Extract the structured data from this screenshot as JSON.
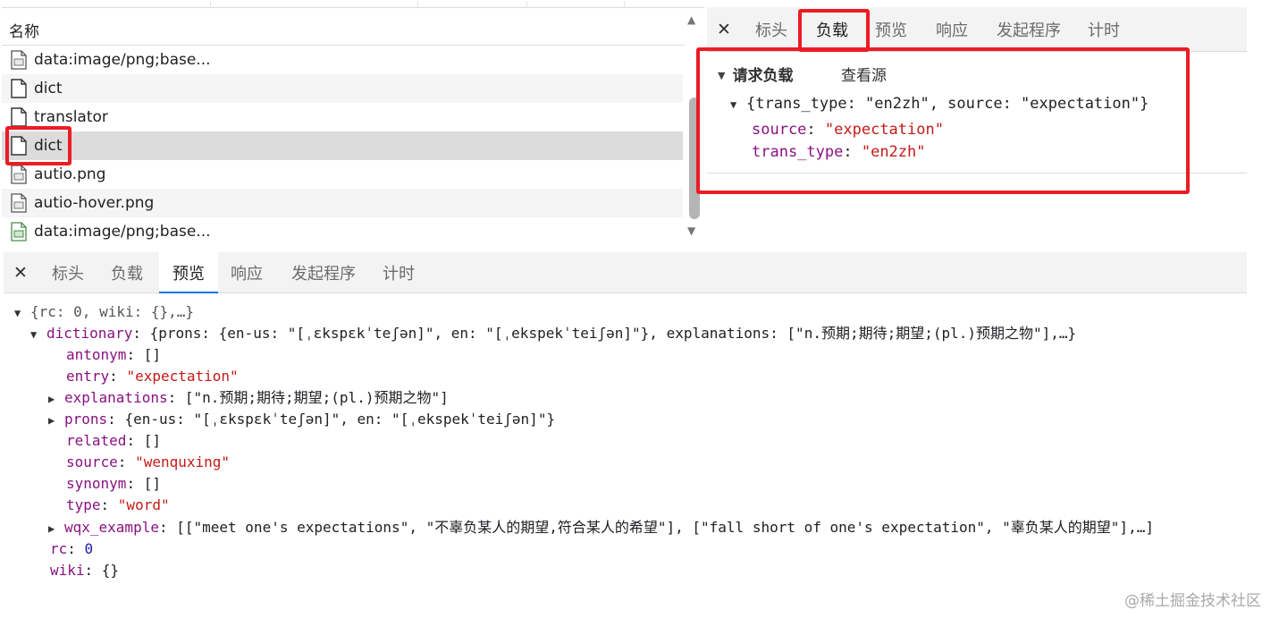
{
  "request_list": {
    "header": "名称",
    "rows": [
      {
        "name": "data:image/png;base...",
        "icon": "image-file-icon"
      },
      {
        "name": "dict",
        "icon": "document-file-icon"
      },
      {
        "name": "translator",
        "icon": "document-file-icon"
      },
      {
        "name": "dict",
        "icon": "document-file-icon",
        "selected": true
      },
      {
        "name": "autio.png",
        "icon": "image-file-icon"
      },
      {
        "name": "autio-hover.png",
        "icon": "image-file-icon"
      },
      {
        "name": "data:image/png;base...",
        "icon": "image-file-green-icon"
      }
    ]
  },
  "detail_tabs": {
    "close": "✕",
    "items": [
      "标头",
      "负载",
      "预览",
      "响应",
      "发起程序",
      "计时"
    ],
    "active": "负载"
  },
  "payload": {
    "title": "请求负载",
    "view_source": "查看源",
    "summary": "{trans_type: \"en2zh\", source: \"expectation\"}",
    "fields": [
      {
        "key": "source",
        "value": "\"expectation\""
      },
      {
        "key": "trans_type",
        "value": "\"en2zh\""
      }
    ]
  },
  "preview_tabs": {
    "close": "✕",
    "items": [
      "标头",
      "负载",
      "预览",
      "响应",
      "发起程序",
      "计时"
    ],
    "active": "预览"
  },
  "preview": {
    "root": "{rc: 0, wiki: {},…}",
    "dictionary_key": "dictionary",
    "dictionary_summary": "{prons: {en-us: \"[ˌɛkspɛkˈteʃən]\", en: \"[ˌekspekˈteiʃən]\"}, explanations: [\"n.预期;期待;期望;(pl.)预期之物\"],…}",
    "antonym_key": "antonym",
    "antonym_val": "[]",
    "entry_key": "entry",
    "entry_val": "\"expectation\"",
    "explanations_key": "explanations",
    "explanations_val": "[\"n.预期;期待;期望;(pl.)预期之物\"]",
    "prons_key": "prons",
    "prons_val": "{en-us: \"[ˌɛkspɛkˈteʃən]\", en: \"[ˌekspekˈteiʃən]\"}",
    "related_key": "related",
    "related_val": "[]",
    "source_key": "source",
    "source_val": "\"wenquxing\"",
    "synonym_key": "synonym",
    "synonym_val": "[]",
    "type_key": "type",
    "type_val": "\"word\"",
    "wqx_key": "wqx_example",
    "wqx_val": "[[\"meet one's expectations\", \"不辜负某人的期望,符合某人的希望\"], [\"fall short of one's expectation\", \"辜负某人的期望\"],…]",
    "rc_key": "rc",
    "rc_val": "0",
    "wiki_key": "wiki",
    "wiki_val": "{}"
  },
  "watermark": "@稀土掘金技术社区",
  "colors": {
    "highlight_box": "#ec1c24",
    "key": "#881280",
    "string": "#c41a16",
    "number": "#1a1aa6",
    "tab_underline": "#1a73e8"
  }
}
